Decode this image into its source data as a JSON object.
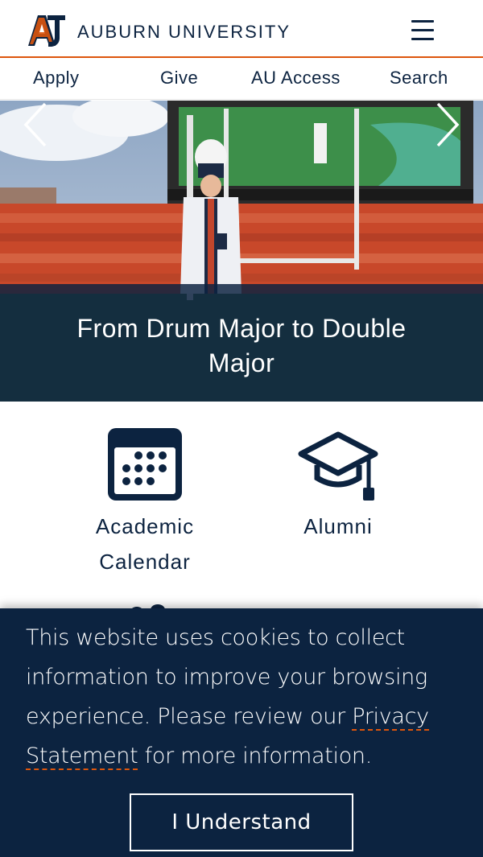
{
  "header": {
    "logo_text": "AUBURN UNIVERSITY",
    "menu_icon": "hamburger-icon",
    "rule_color": "#dd550c",
    "brand_color": "#0c2340"
  },
  "utility_nav": {
    "items": [
      {
        "label": "Apply"
      },
      {
        "label": "Give"
      },
      {
        "label": "AU Access"
      },
      {
        "label": "Search"
      }
    ]
  },
  "hero": {
    "title": "From Drum Major to Double Major",
    "prev_icon": "chevron-left-icon",
    "next_icon": "chevron-right-icon"
  },
  "quick_links": [
    {
      "label": "Academic Calendar",
      "icon": "calendar-icon"
    },
    {
      "label": "Alumni",
      "icon": "graduation-cap-icon"
    }
  ],
  "cookie_banner": {
    "text_before": "This website uses cookies to collect information to improve your browsing experience. Please review our ",
    "link_text": "Privacy Statement",
    "text_after": " for more information.",
    "button_label": "I Understand"
  }
}
